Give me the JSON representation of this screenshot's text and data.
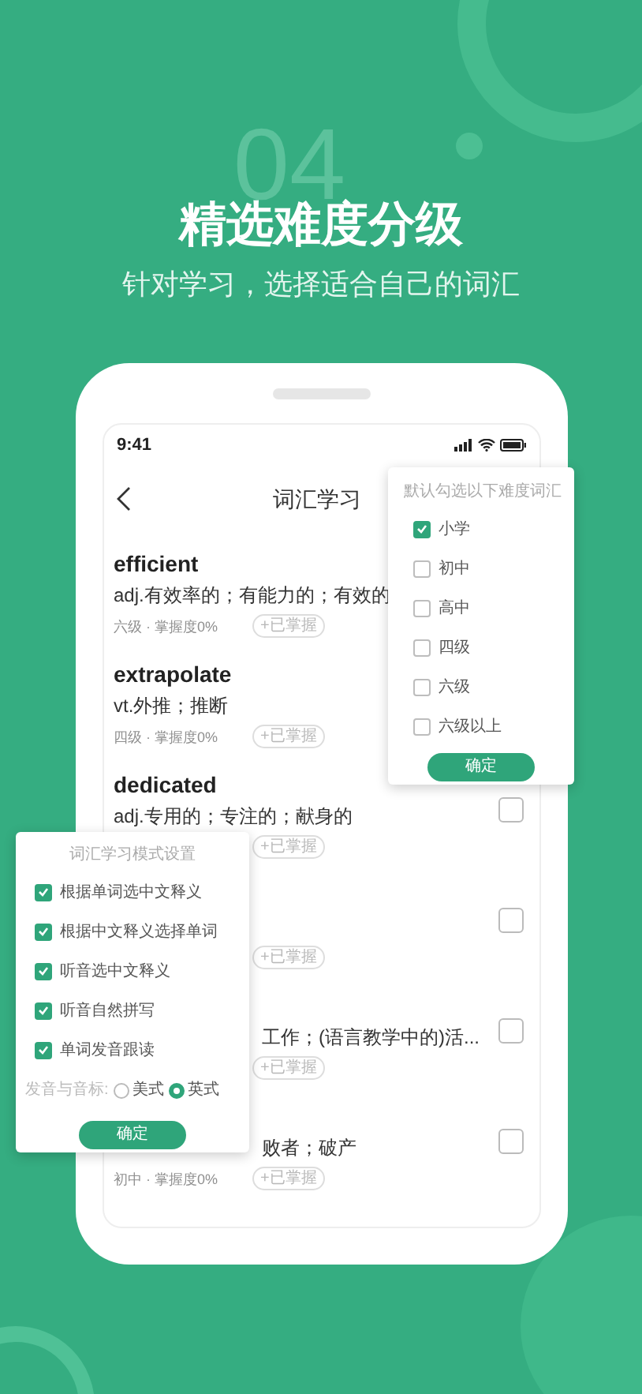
{
  "hero": {
    "number": "04",
    "title": "精选难度分级",
    "subtitle": "针对学习，选择适合自己的词汇"
  },
  "status_bar": {
    "time": "9:41"
  },
  "nav": {
    "title": "词汇学习"
  },
  "words": [
    {
      "word": "efficient",
      "meaning": "adj.有效率的；有能力的；有效的",
      "meta": "六级 · 掌握度0%",
      "chip": "+已掌握"
    },
    {
      "word": "extrapolate",
      "meaning": "vt.外推；推断",
      "meta": "四级 · 掌握度0%",
      "chip": "+已掌握"
    },
    {
      "word": "dedicated",
      "meaning": "adj.专用的；专注的；献身的",
      "chip": "+已掌握",
      "checked": false
    },
    {
      "chip": "+已掌握",
      "checked": false
    },
    {
      "meaning": "工作；(语言教学中的)活...",
      "chip": "+已掌握",
      "checked": false
    },
    {
      "meaning": "败者；破产",
      "meta": "初中 · 掌握度0%",
      "chip": "+已掌握",
      "checked": false
    }
  ],
  "level_popup": {
    "title": "默认勾选以下难度词汇",
    "options": [
      {
        "label": "小学",
        "checked": true
      },
      {
        "label": "初中",
        "checked": false
      },
      {
        "label": "高中",
        "checked": false
      },
      {
        "label": "四级",
        "checked": false
      },
      {
        "label": "六级",
        "checked": false
      },
      {
        "label": "六级以上",
        "checked": false
      }
    ],
    "button": "确定"
  },
  "mode_popup": {
    "title": "词汇学习模式设置",
    "options": [
      {
        "label": "根据单词选中文释义",
        "checked": true
      },
      {
        "label": "根据中文释义选择单词",
        "checked": true
      },
      {
        "label": "听音选中文释义",
        "checked": true
      },
      {
        "label": "听音自然拼写",
        "checked": true
      },
      {
        "label": "单词发音跟读",
        "checked": true
      }
    ],
    "accent_label": "发音与音标:",
    "accents": [
      {
        "label": "美式",
        "selected": false
      },
      {
        "label": "英式",
        "selected": true
      }
    ],
    "button": "确定"
  }
}
